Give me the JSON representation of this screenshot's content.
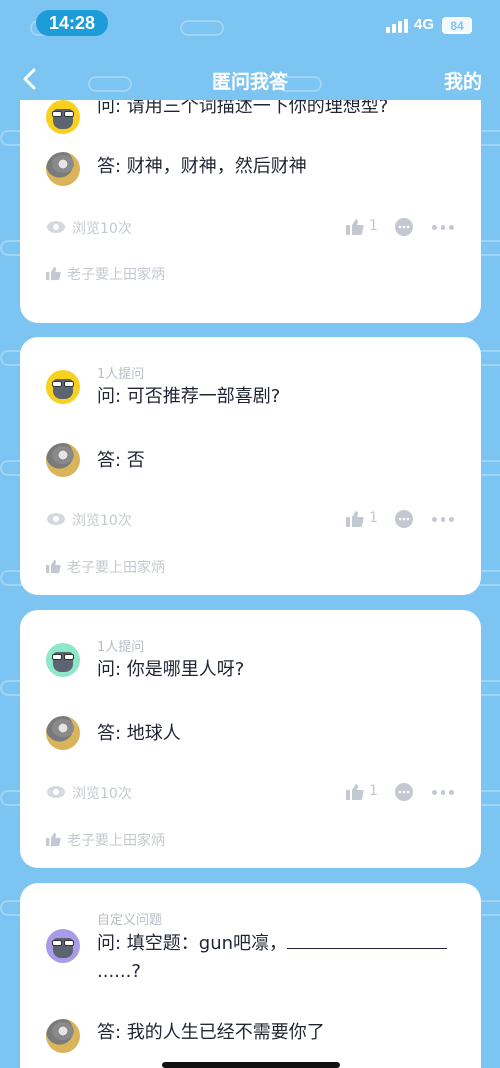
{
  "status_bar": {
    "time": "14:28",
    "network": "4G",
    "battery": "84"
  },
  "nav": {
    "title": "匿问我答",
    "right_label": "我的"
  },
  "colors": {
    "background": "#7cc4f1",
    "card": "#ffffff",
    "accent": "#1e9bd9"
  },
  "cards": [
    {
      "asker_label": "",
      "question": "问: 请用三个词描述一下你的理想型?",
      "answer": "答: 财神，财神，然后财神",
      "views": "浏览10次",
      "likes": "1",
      "liker": "老子要上田家炳",
      "asker_avatar_color": "#f7d11e"
    },
    {
      "asker_label": "1人提问",
      "question": "问: 可否推荐一部喜剧?",
      "answer": "答: 否",
      "views": "浏览10次",
      "likes": "1",
      "liker": "老子要上田家炳",
      "asker_avatar_color": "#f7d11e"
    },
    {
      "asker_label": "1人提问",
      "question": "问: 你是哪里人呀?",
      "answer": "答: 地球人",
      "views": "浏览10次",
      "likes": "1",
      "liker": "老子要上田家炳",
      "asker_avatar_color": "#8ee8c8"
    },
    {
      "asker_label": "自定义问题",
      "question_prefix": "问: 填空题：gun吧凛，",
      "question_suffix": "......?",
      "answer": "答: 我的人生已经不需要你了",
      "asker_avatar_color": "#a99be8"
    }
  ]
}
